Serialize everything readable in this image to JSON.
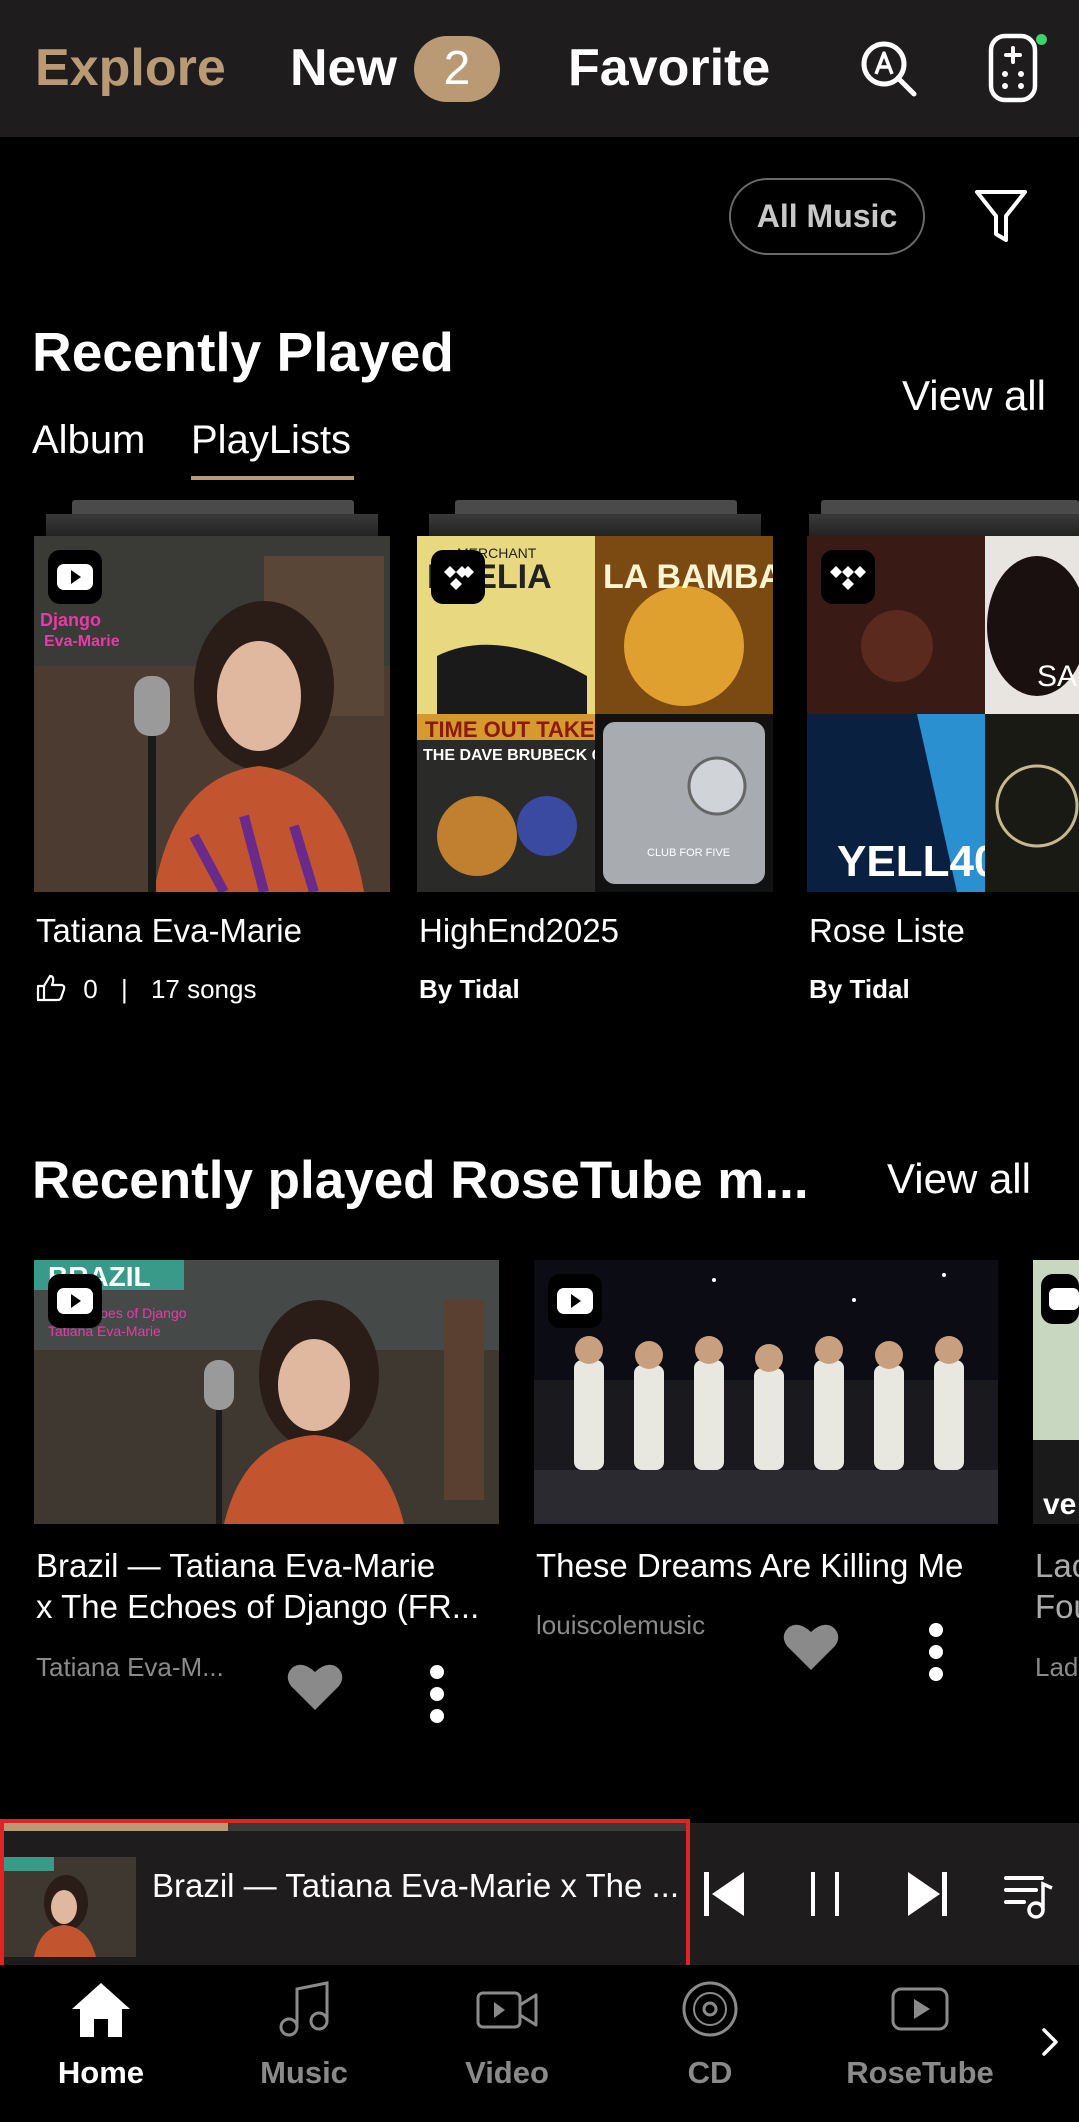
{
  "top_tabs": {
    "explore": "Explore",
    "new": "New",
    "new_count": "2",
    "favorite": "Favorite"
  },
  "filter": {
    "all_music": "All Music"
  },
  "recently_played": {
    "title": "Recently Played",
    "view_all": "View all",
    "subtabs": [
      "Album",
      "PlayLists"
    ],
    "active_subtab": "PlayLists",
    "items": [
      {
        "title": "Tatiana Eva-Marie",
        "likes": "0",
        "sep": "|",
        "songs": "17 songs",
        "source_icon": "youtube-icon"
      },
      {
        "title": "HighEnd2025",
        "by": "By Tidal",
        "source_icon": "tidal-icon"
      },
      {
        "title": "Rose Liste",
        "by": "By Tidal",
        "source_icon": "tidal-icon"
      }
    ]
  },
  "rosetube": {
    "title": "Recently played RoseTube m...",
    "view_all": "View all",
    "items": [
      {
        "title_line1": "Brazil — Tatiana Eva-Marie",
        "title_line2": "x The Echoes of Django (FR...",
        "artist": "Tatiana Eva-M..."
      },
      {
        "title_line1": "These Dreams Are Killing Me",
        "title_line2": "",
        "artist": "louiscolemusic"
      },
      {
        "title_line1": "Lac",
        "title_line2": "Fou",
        "artist": "Lad"
      }
    ]
  },
  "mini_player": {
    "title": "Brazil — Tatiana Eva-Marie x The ...",
    "progress": 0.33
  },
  "bottom_nav": [
    "Home",
    "Music",
    "Video",
    "CD",
    "RoseTube"
  ],
  "colors": {
    "accent": "#b99a74",
    "header_bg": "#1e1c1c",
    "highlight": "#e02424"
  }
}
